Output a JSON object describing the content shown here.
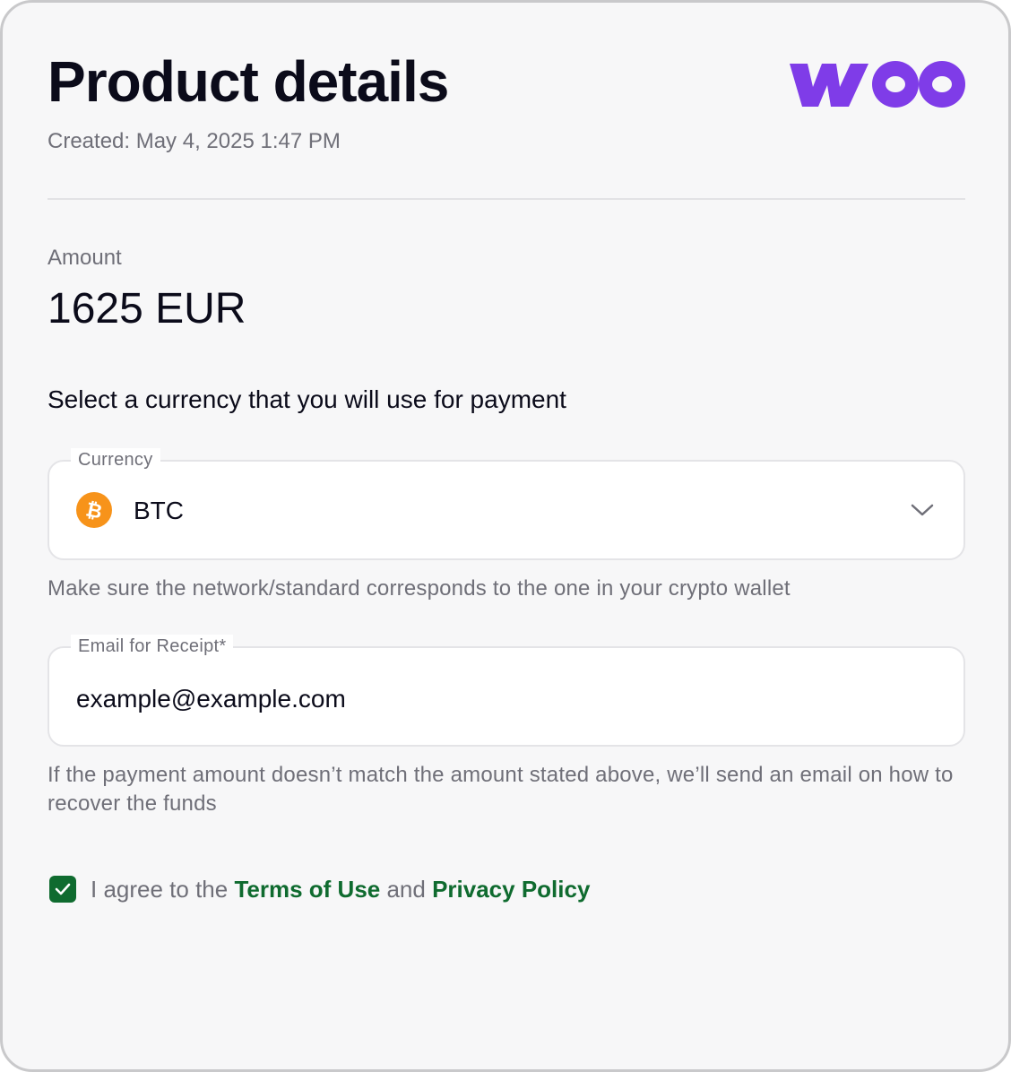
{
  "header": {
    "title": "Product details",
    "created": "Created: May 4, 2025 1:47 PM",
    "logo_text": "woo",
    "logo_color": "#7f3ce8"
  },
  "amount": {
    "label": "Amount",
    "value": "1625 EUR"
  },
  "instruction": "Select a currency that you will use for payment",
  "currency_field": {
    "label": "Currency",
    "selected": "BTC",
    "icon": "bitcoin-icon",
    "icon_color": "#f7931a",
    "dropdown_icon": "chevron-down-icon",
    "hint": "Make sure the network/standard corresponds to the one in your crypto wallet"
  },
  "email_field": {
    "label": "Email for Receipt*",
    "value": "example@example.com",
    "hint": "If the payment amount doesn’t match the amount stated above, we’ll send an email on how to recover the funds"
  },
  "agreement": {
    "checked": true,
    "prefix": "I agree to the ",
    "terms_label": "Terms of Use",
    "middle": " and ",
    "privacy_label": "Privacy Policy",
    "link_color": "#0f6b2f"
  }
}
